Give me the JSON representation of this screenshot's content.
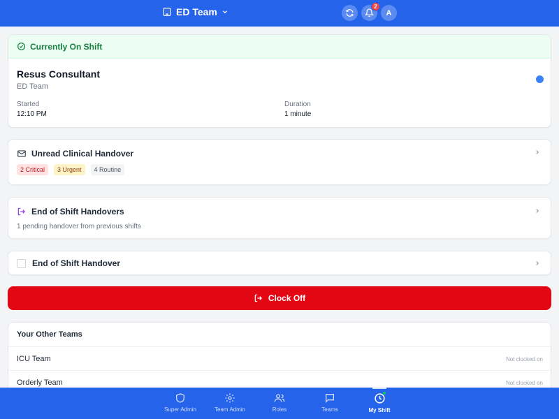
{
  "header": {
    "team_name": "ED Team",
    "notification_count": "2",
    "avatar_initial": "A"
  },
  "current_shift": {
    "status_label": "Currently On Shift",
    "role": "Resus Consultant",
    "team": "ED Team",
    "started_label": "Started",
    "started_value": "12:10 PM",
    "duration_label": "Duration",
    "duration_value": "1 minute"
  },
  "unread_handover": {
    "title": "Unread Clinical Handover",
    "chips": {
      "critical": "2 Critical",
      "urgent": "3 Urgent",
      "routine": "4 Routine"
    }
  },
  "end_of_shift_handovers": {
    "title": "End of Shift Handovers",
    "subtitle": "1 pending handover from previous shifts"
  },
  "end_of_shift_handover": {
    "title": "End of Shift Handover"
  },
  "clock_off": {
    "label": "Clock Off"
  },
  "other_teams": {
    "title": "Your Other Teams",
    "teams": [
      {
        "name": "ICU Team",
        "status": "Not clocked on"
      },
      {
        "name": "Orderly Team",
        "status": "Not clocked on"
      }
    ]
  },
  "bottom_nav": [
    {
      "label": "Super Admin",
      "icon": "shield-icon"
    },
    {
      "label": "Team Admin",
      "icon": "gear-icon"
    },
    {
      "label": "Roles",
      "icon": "users-icon"
    },
    {
      "label": "Teams",
      "icon": "chat-icon"
    },
    {
      "label": "My Shift",
      "icon": "clock-icon",
      "active": true
    }
  ],
  "colors": {
    "primary": "#2563eb",
    "success": "#15803d",
    "danger": "#e30613",
    "status_dot": "#3b82f6"
  }
}
